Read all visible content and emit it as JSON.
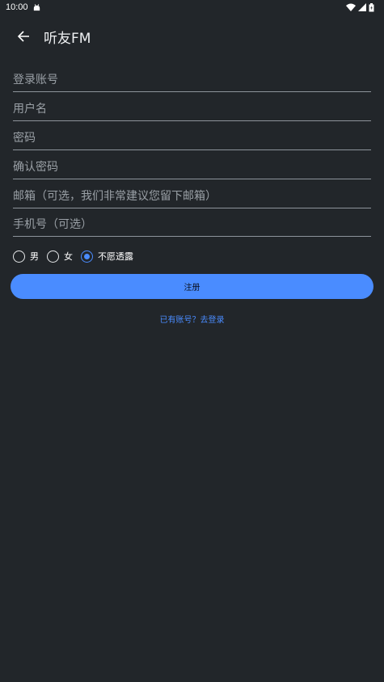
{
  "status_bar": {
    "time": "10:00",
    "icons": [
      "android-notification-icon",
      "wifi-icon",
      "signal-icon",
      "battery-icon"
    ]
  },
  "toolbar": {
    "title": "听友FM",
    "back_icon": "arrow-back-icon"
  },
  "form": {
    "account_placeholder": "登录账号",
    "username_placeholder": "用户名",
    "password_placeholder": "密码",
    "confirm_password_placeholder": "确认密码",
    "email_placeholder": "邮箱（可选，我们非常建议您留下邮箱）",
    "phone_placeholder": "手机号（可选）"
  },
  "gender": {
    "options": [
      "男",
      "女",
      "不愿透露"
    ],
    "selected": "不愿透露"
  },
  "register_button": "注册",
  "login_link": "已有账号？去登录",
  "colors": {
    "background": "#22262a",
    "accent": "#4a8cff",
    "underline": "#8d949b"
  }
}
